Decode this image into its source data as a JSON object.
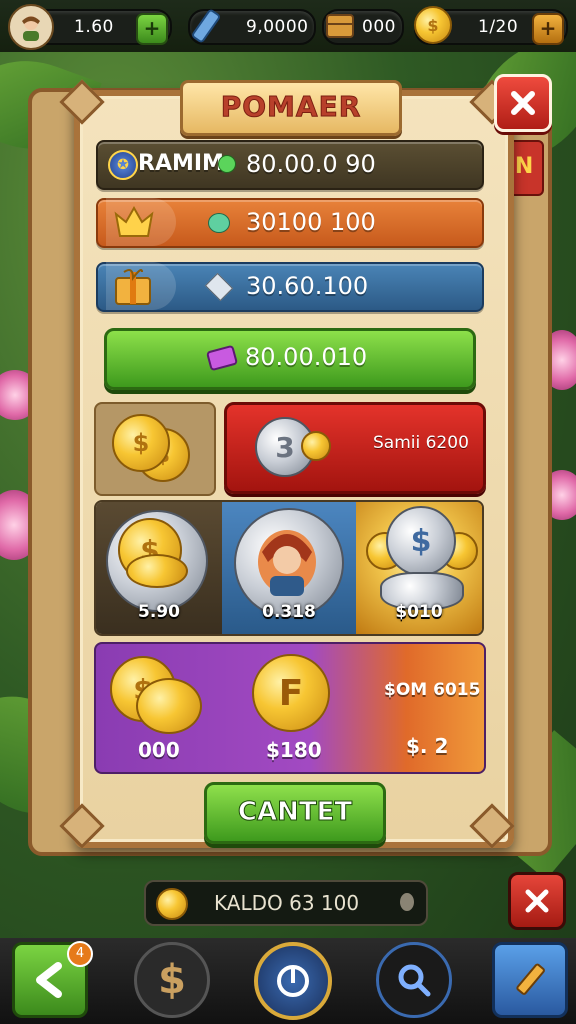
{
  "topbar": {
    "res1_value": "1.60",
    "res2_value": "9,0000",
    "res3_value": "000",
    "res4_value": "1/20"
  },
  "panel": {
    "title": "POMAER",
    "row1_label": "RAMIM",
    "row1_value": "80.00.0 90",
    "row2_value": "30100 100",
    "row3_value": "30.60.100",
    "row4_value": "80.00.010",
    "offer_b_coin": "3",
    "offer_b_label": "Samii 6200",
    "tile1_label": "5.90",
    "tile2_label": "0.318",
    "tile3_label": "$010",
    "bundle_amount1": "000",
    "bundle_amount2": "$180",
    "bundle_coin_letter": "F",
    "bundle_side_title": "$OM 6015",
    "bundle_side_value": "$. 2",
    "confirm_label": "CANTET",
    "side_peek": "IN"
  },
  "bottom": {
    "balance_text": "KALDO 63 100",
    "nav_badge": "4"
  },
  "colors": {
    "accent_green": "#3e9a1d",
    "accent_red": "#b01e16",
    "gold": "#f7c633"
  },
  "icons": [
    "avatar-icon",
    "crystal-icon",
    "crate-icon",
    "gold-coin-icon",
    "plus-icon",
    "close-icon",
    "crown-icon",
    "gift-icon",
    "gem-icon",
    "tag-icon",
    "coin-stack-icon",
    "hero-portrait-icon",
    "back-arrow-icon",
    "dollar-icon",
    "target-icon",
    "magnifier-icon",
    "pencil-icon",
    "info-icon"
  ]
}
